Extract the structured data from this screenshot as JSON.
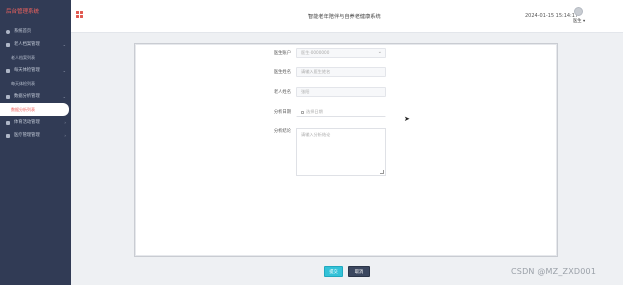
{
  "sidebar": {
    "brand": "后台管理系统",
    "items": [
      {
        "label": "系统首页",
        "chevron": ""
      },
      {
        "label": "老人档案管理",
        "chevron": "⌄"
      },
      {
        "label": "老人档案列表",
        "sub": true
      },
      {
        "label": "每天体检管理",
        "chevron": "⌄"
      },
      {
        "label": "每天体检列表",
        "sub": true
      },
      {
        "label": "数据分析管理",
        "chevron": "⌄"
      },
      {
        "label": "数据分析列表",
        "sub": true,
        "active": true
      },
      {
        "label": "体育活动管理",
        "chevron": "›"
      },
      {
        "label": "医疗管理管理",
        "chevron": "›"
      }
    ]
  },
  "header": {
    "title": "智能老年陪伴与自养老健康系统",
    "datetime": "2024-01-15 15:14:17",
    "user": "医生 ▾"
  },
  "form": {
    "fields": [
      {
        "label": "医生账户",
        "placeholder": "医生·0000000",
        "type": "select"
      },
      {
        "label": "医生姓名",
        "placeholder": "请输入医生姓名",
        "type": "text"
      },
      {
        "label": "老人姓名",
        "placeholder": "张阳",
        "type": "text"
      },
      {
        "label": "分析日期",
        "placeholder": "选择日期",
        "type": "date"
      },
      {
        "label": "分析结论",
        "placeholder": "请输入分析结论",
        "type": "textarea"
      }
    ],
    "submit_label": "提交",
    "cancel_label": "取消"
  },
  "watermark": "CSDN @MZ_ZXD001",
  "colors": {
    "sidebar_bg": "#313b55",
    "brand": "#f0625e",
    "active_item": "#ee5a57",
    "submit": "#33c2d8",
    "cancel": "#3b475f"
  }
}
